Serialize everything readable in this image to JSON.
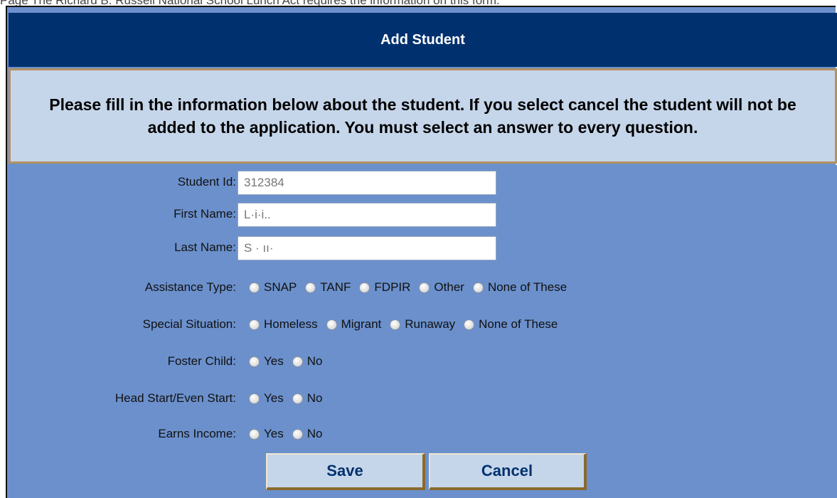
{
  "page": {
    "top_clipped_text": "Page The Richard B. Russell National School Lunch Act requires the information on this form."
  },
  "dialog": {
    "title": "Add Student",
    "instructions": "Please fill in the information below about the student. If you select cancel the student will not be added to the application. You must select an answer to every question."
  },
  "form": {
    "student_id": {
      "label": "Student Id:",
      "value": "312384"
    },
    "first_name": {
      "label": "First Name:",
      "value": "L·i·i.."
    },
    "last_name": {
      "label": "Last Name:",
      "value": "S · ıı·"
    },
    "assistance_type": {
      "label": "Assistance Type:",
      "options": [
        "SNAP",
        "TANF",
        "FDPIR",
        "Other",
        "None of These"
      ]
    },
    "special_situation": {
      "label": "Special Situation:",
      "options": [
        "Homeless",
        "Migrant",
        "Runaway",
        "None of These"
      ]
    },
    "foster_child": {
      "label": "Foster Child:",
      "options": [
        "Yes",
        "No"
      ]
    },
    "head_start": {
      "label": "Head Start/Even Start:",
      "options": [
        "Yes",
        "No"
      ]
    },
    "earns_income": {
      "label": "Earns Income:",
      "options": [
        "Yes",
        "No"
      ]
    }
  },
  "buttons": {
    "save_label": "Save",
    "cancel_label": "Cancel"
  },
  "colors": {
    "title_bar": "#00316e",
    "form_background": "#6b90cc",
    "info_background": "#c6d6ea",
    "info_border": "#b59161"
  }
}
